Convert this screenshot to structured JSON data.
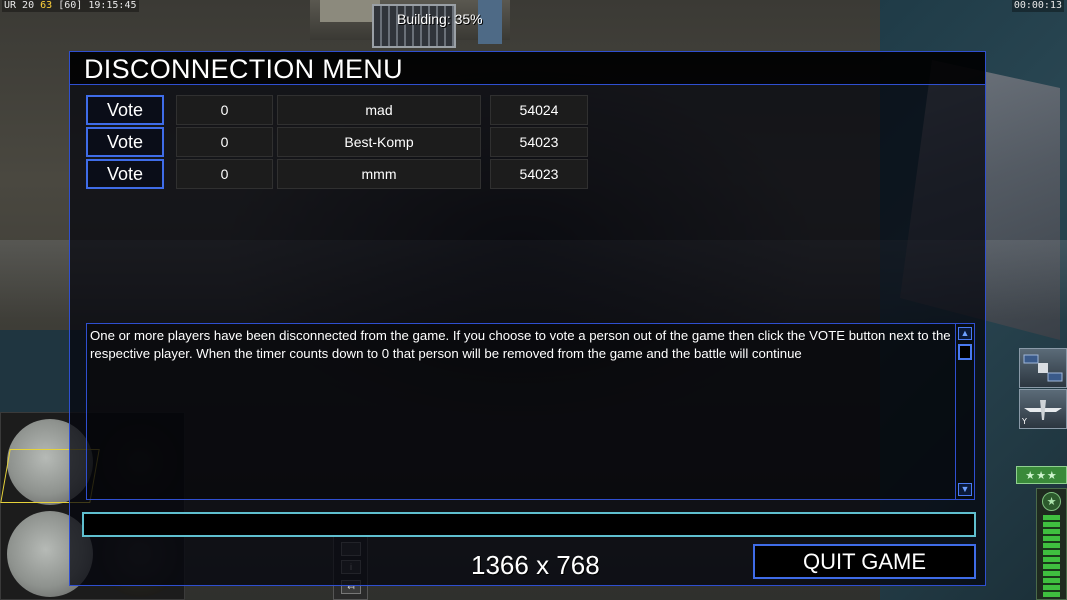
{
  "hud": {
    "fps_prefix": "UR 20",
    "fps_value": "63",
    "fps_suffix": "[60] 19:15:45",
    "game_timer": "00:00:13",
    "building_progress": "Building: 35%"
  },
  "dialog": {
    "title": "DISCONNECTION MENU",
    "players": [
      {
        "vote_label": "Vote",
        "votes": "0",
        "name": "mad",
        "port": "54024"
      },
      {
        "vote_label": "Vote",
        "votes": "0",
        "name": "Best-Komp",
        "port": "54023"
      },
      {
        "vote_label": "Vote",
        "votes": "0",
        "name": "mmm",
        "port": "54023"
      }
    ],
    "message": "One or more players have been disconnected from the game. If you choose to vote a person out of the game then click the VOTE button next to the respective player. When the timer counts down to 0 that person will be removed from the game and the battle will continue",
    "chat_value": "",
    "quit_label": "QUIT GAME"
  },
  "overlay": {
    "resolution": "1366 x 768"
  },
  "side_panel": {
    "rank_stars": "★★★",
    "icons": [
      "satellite-icon",
      "drone-icon",
      "power-star-icon"
    ]
  },
  "colors": {
    "dialog_border": "#2f4fd0",
    "button_border": "#3f6ce8",
    "chat_border": "#5fbfcf",
    "power_green": "#3fbf3f",
    "fps_highlight": "#ffd23a"
  }
}
